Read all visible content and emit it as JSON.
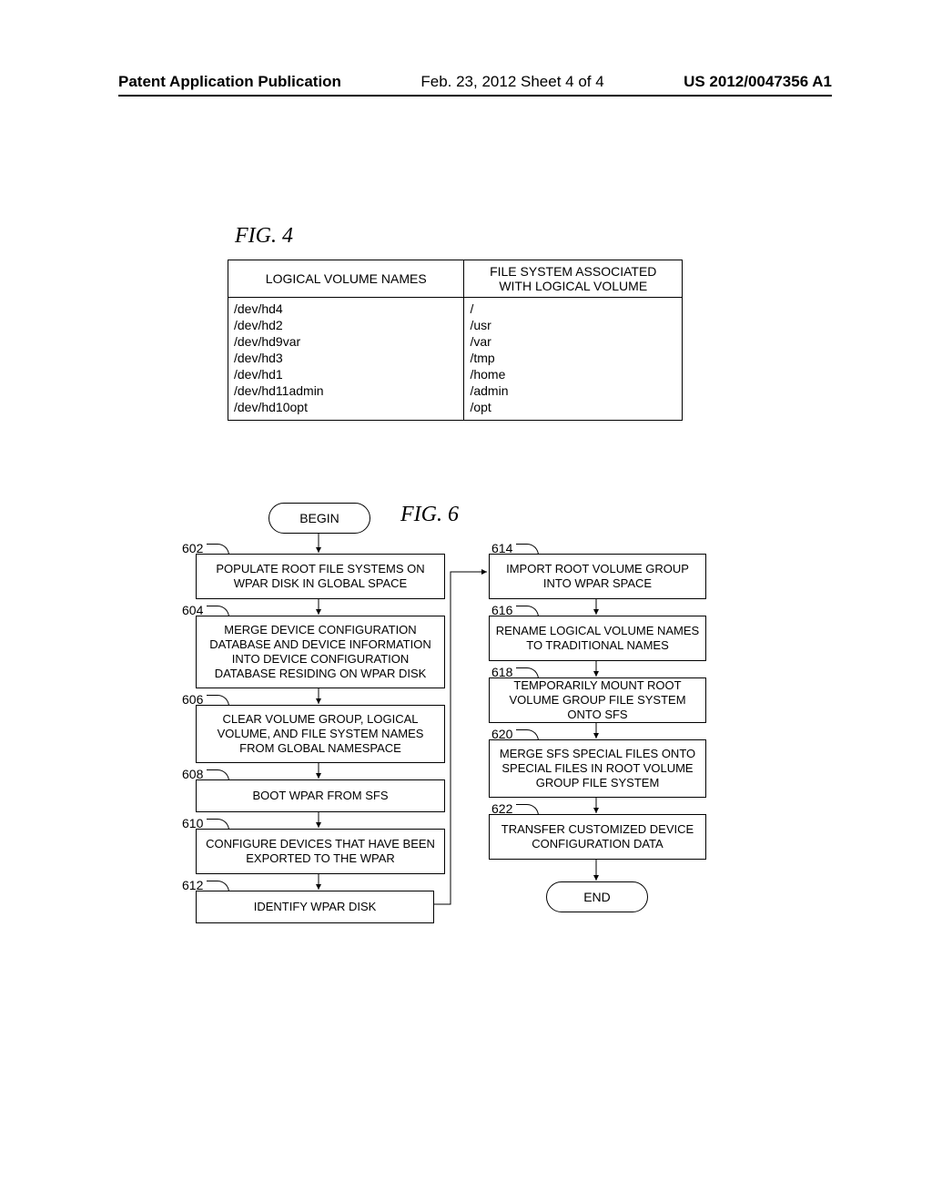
{
  "header": {
    "left": "Patent Application Publication",
    "center": "Feb. 23, 2012  Sheet 4 of 4",
    "right": "US 2012/0047356 A1"
  },
  "fig4": {
    "label": "FIG. 4",
    "col1": "LOGICAL VOLUME NAMES",
    "col2": "FILE SYSTEM ASSOCIATED WITH LOGICAL VOLUME",
    "rows": [
      {
        "lv": "/dev/hd4",
        "fs": "/"
      },
      {
        "lv": "/dev/hd2",
        "fs": "/usr"
      },
      {
        "lv": "/dev/hd9var",
        "fs": "/var"
      },
      {
        "lv": "/dev/hd3",
        "fs": "/tmp"
      },
      {
        "lv": "/dev/hd1",
        "fs": "/home"
      },
      {
        "lv": "/dev/hd11admin",
        "fs": "/admin"
      },
      {
        "lv": "/dev/hd10opt",
        "fs": "/opt"
      }
    ]
  },
  "fig6": {
    "label": "FIG. 6",
    "begin": "BEGIN",
    "end": "END",
    "refs": {
      "602": "602",
      "604": "604",
      "606": "606",
      "608": "608",
      "610": "610",
      "612": "612",
      "614": "614",
      "616": "616",
      "618": "618",
      "620": "620",
      "622": "622"
    },
    "steps": {
      "602": "POPULATE ROOT FILE SYSTEMS ON WPAR DISK IN GLOBAL SPACE",
      "604": "MERGE DEVICE CONFIGURATION DATABASE AND DEVICE INFORMATION INTO DEVICE CONFIGURATION DATABASE RESIDING ON WPAR DISK",
      "606": "CLEAR VOLUME GROUP, LOGICAL VOLUME, AND FILE SYSTEM NAMES FROM GLOBAL NAMESPACE",
      "608": "BOOT WPAR FROM SFS",
      "610": "CONFIGURE DEVICES THAT HAVE BEEN EXPORTED TO THE WPAR",
      "612": "IDENTIFY WPAR DISK",
      "614": "IMPORT ROOT VOLUME GROUP INTO WPAR SPACE",
      "616": "RENAME LOGICAL VOLUME NAMES TO TRADITIONAL NAMES",
      "618": "TEMPORARILY MOUNT ROOT VOLUME GROUP FILE SYSTEM ONTO SFS",
      "620": "MERGE SFS SPECIAL FILES ONTO SPECIAL FILES IN ROOT VOLUME GROUP FILE SYSTEM",
      "622": "TRANSFER CUSTOMIZED DEVICE CONFIGURATION DATA"
    }
  }
}
